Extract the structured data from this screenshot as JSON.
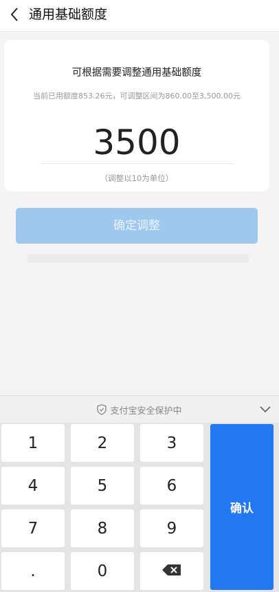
{
  "header": {
    "title": "通用基础额度"
  },
  "card": {
    "title": "可根据需要调整通用基础额度",
    "subtitle": "当前已用额度853.26元，可调整区间为860.00至3,500.00元",
    "amount": "3500",
    "hint": "（调整以10为单位）"
  },
  "actions": {
    "confirm_adjust_label": "确定调整"
  },
  "keyboard": {
    "secure_label": "支付宝安全保护中",
    "keys": [
      "1",
      "2",
      "3",
      "4",
      "5",
      "6",
      "7",
      "8",
      "9",
      ".",
      "0"
    ],
    "confirm_label": "确认",
    "icons": [
      "back-icon",
      "shield-icon",
      "chevron-down-icon",
      "backspace-icon"
    ]
  },
  "colors": {
    "primary": "#2277f2",
    "button_disabled": "#9ec8ee",
    "background": "#f4f4f4"
  }
}
